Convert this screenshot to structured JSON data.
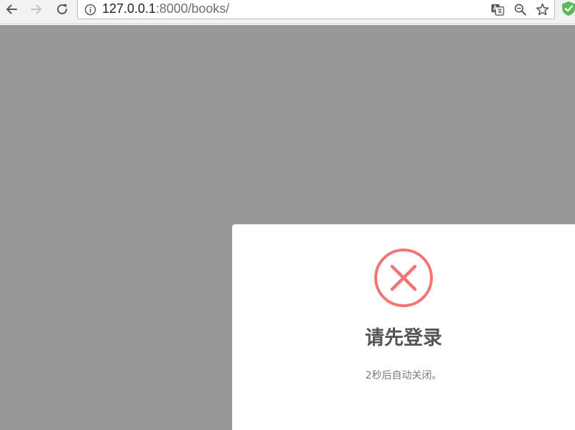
{
  "browser": {
    "url_host": "127.0.0.1",
    "url_rest": ":8000/books/",
    "icons": {
      "back": "arrow-left-icon",
      "forward": "arrow-right-icon",
      "reload": "reload-icon",
      "info": "info-icon",
      "translate": "translate-icon",
      "zoom": "zoom-out-icon",
      "bookmark": "star-icon",
      "extension": "shield-check-icon"
    }
  },
  "dialog": {
    "icon": "error-x-icon",
    "title": "请先登录",
    "message": "2秒后自动关闭。"
  },
  "colors": {
    "overlay": "#989898",
    "error": "#f27474",
    "title": "#545454",
    "message": "#797979",
    "extension": "#5cb85c"
  }
}
